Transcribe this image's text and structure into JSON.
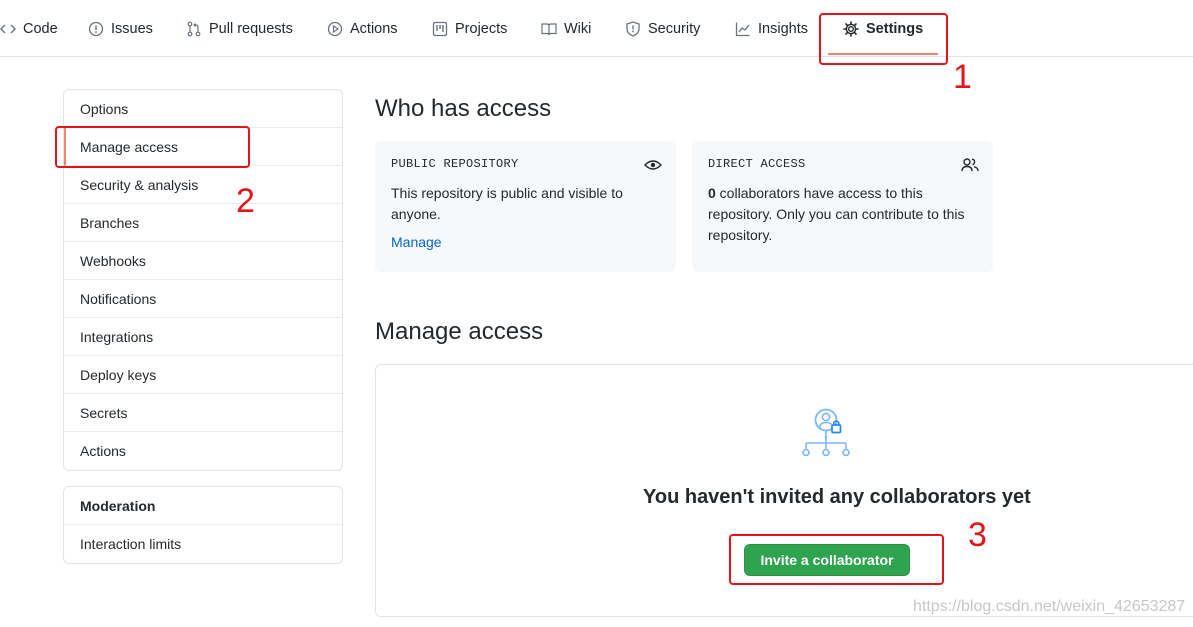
{
  "nav": {
    "tabs": [
      {
        "label": "Code",
        "icon": "code-icon"
      },
      {
        "label": "Issues",
        "icon": "issue-icon"
      },
      {
        "label": "Pull requests",
        "icon": "pull-request-icon"
      },
      {
        "label": "Actions",
        "icon": "play-icon"
      },
      {
        "label": "Projects",
        "icon": "project-icon"
      },
      {
        "label": "Wiki",
        "icon": "book-icon"
      },
      {
        "label": "Security",
        "icon": "shield-icon"
      },
      {
        "label": "Insights",
        "icon": "graph-icon"
      },
      {
        "label": "Settings",
        "icon": "gear-icon",
        "active": true
      }
    ]
  },
  "sidebar": {
    "items": [
      {
        "label": "Options"
      },
      {
        "label": "Manage access",
        "selected": true
      },
      {
        "label": "Security & analysis"
      },
      {
        "label": "Branches"
      },
      {
        "label": "Webhooks"
      },
      {
        "label": "Notifications"
      },
      {
        "label": "Integrations"
      },
      {
        "label": "Deploy keys"
      },
      {
        "label": "Secrets"
      },
      {
        "label": "Actions"
      }
    ],
    "moderation": {
      "heading": "Moderation",
      "items": [
        {
          "label": "Interaction limits"
        }
      ]
    }
  },
  "who_has_access": {
    "title": "Who has access",
    "public_card": {
      "title": "PUBLIC REPOSITORY",
      "icon": "eye-icon",
      "body": "This repository is public and visible to anyone.",
      "link": "Manage"
    },
    "direct_card": {
      "title": "DIRECT ACCESS",
      "icon": "people-icon",
      "count": "0",
      "body": " collaborators have access to this repository. Only you can contribute to this repository."
    }
  },
  "manage_access": {
    "title": "Manage access",
    "empty_icon": "collaborators-lock-icon",
    "empty_title": "You haven't invited any collaborators yet",
    "invite_button": "Invite a collaborator"
  },
  "annotations": {
    "one": "1",
    "two": "2",
    "three": "3",
    "color": "#e3151a"
  },
  "watermark": "https://blog.csdn.net/weixin_42653287",
  "colors": {
    "accent_underline": "#f9826c",
    "link": "#0366d6",
    "button_green": "#2ea44f"
  }
}
